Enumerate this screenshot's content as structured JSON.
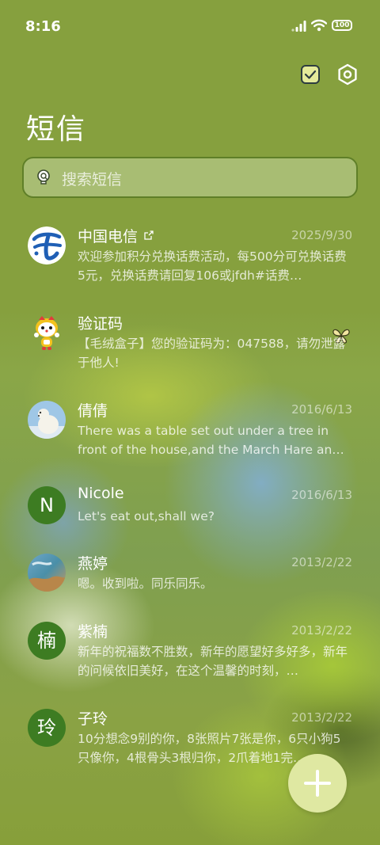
{
  "status": {
    "time": "8:16",
    "battery": "100"
  },
  "header": {
    "title": "短信"
  },
  "search": {
    "placeholder": "搜索短信"
  },
  "conversations": [
    {
      "name": "中国电信",
      "date": "2025/9/30",
      "preview": "欢迎参加积分兑换话费活动，每500分可兑换话费5元，兑换话费请回复106或jfdh#话费…"
    },
    {
      "name": "验证码",
      "date": "",
      "preview": "【毛绒盒子】您的验证码为：047588，请勿泄露于他人!"
    },
    {
      "name": "倩倩",
      "date": "2016/6/13",
      "preview": "There was a table set out under a tree in front of the house,and the March Hare an…"
    },
    {
      "name": "Nicole",
      "date": "2016/6/13",
      "avatar_letter": "N",
      "preview": "Let's eat out,shall we?"
    },
    {
      "name": "燕婷",
      "date": "2013/2/22",
      "preview": "嗯。收到啦。同乐同乐。"
    },
    {
      "name": "紫楠",
      "date": "2013/2/22",
      "avatar_letter": "楠",
      "preview": "新年的祝福数不胜数，新年的愿望好多好多，新年的问候依旧美好，在这个温馨的时刻，…"
    },
    {
      "name": "子玲",
      "date": "2013/2/22",
      "avatar_letter": "玲",
      "preview": "10分想念9别的你，8张照片7张是你，6只小狗5只像你，4根骨头3根归你，2爪着地1完…"
    }
  ],
  "icons": {
    "select": "checklist-icon",
    "settings": "settings-icon",
    "search": "lightbulb-search-icon",
    "compose": "plus-icon",
    "pin": "butterfly-icon"
  },
  "colors": {
    "background": "#86a03e",
    "fab": "#dfe8a2",
    "avatar": "#3d7c22"
  }
}
